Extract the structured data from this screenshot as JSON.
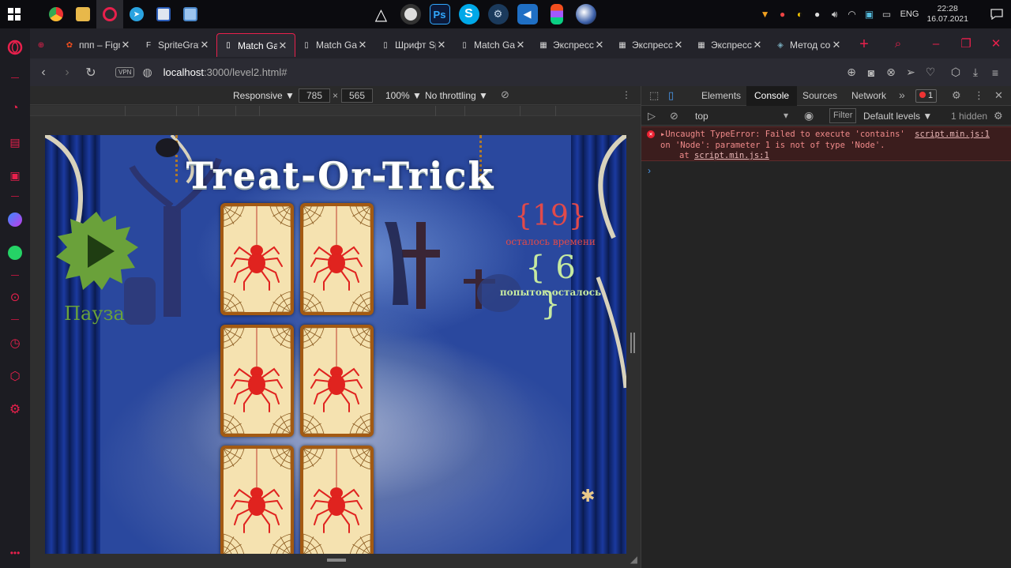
{
  "taskbar": {
    "clock_time": "22:28",
    "clock_date": "16.07.2021",
    "lang": "ENG"
  },
  "tabs": [
    {
      "title": "ппп – Figma"
    },
    {
      "title": "SpriteGraf"
    },
    {
      "title": "Match Game"
    },
    {
      "title": "Match Game"
    },
    {
      "title": "Шрифт Sp"
    },
    {
      "title": "Match Game"
    },
    {
      "title": "Экспресс"
    },
    {
      "title": "Экспресс"
    },
    {
      "title": "Экспресс"
    },
    {
      "title": "Метод со"
    }
  ],
  "address": {
    "vpn": "VPN",
    "host": "localhost",
    "path": ":3000/level2.html#"
  },
  "device_toolbar": {
    "mode": "Responsive ▼",
    "width": "785",
    "height": "565",
    "times": "×",
    "zoom": "100% ▼",
    "throttle": "No throttling ▼"
  },
  "game": {
    "title": "Treat-Or-Trick",
    "pause_label": "Пауза",
    "timer_value": "{19}",
    "timer_label": "осталось времени",
    "tries_value": "{ 6 }",
    "tries_label": "попыток осталось"
  },
  "devtools": {
    "tabs": [
      "Elements",
      "Console",
      "Sources",
      "Network"
    ],
    "more": "»",
    "error_count": "1",
    "context": "top",
    "filter_placeholder": "Filter",
    "levels": "Default levels ▼",
    "hidden": "1 hidden",
    "error": {
      "line1": "▸Uncaught TypeError: Failed to execute 'contains'",
      "line2": "on 'Node': parameter 1 is not of type 'Node'.",
      "line3_prefix": "at ",
      "line3_link": "script.min.js:1",
      "source": "script.min.js:1"
    },
    "prompt": "›"
  },
  "colors": {
    "accent": "#e8204c",
    "timer": "#e14a4a",
    "tries": "#c6e9a0",
    "card_border": "#a35a12",
    "card_face": "#f5e2b0",
    "pause": "#6aa13a"
  }
}
